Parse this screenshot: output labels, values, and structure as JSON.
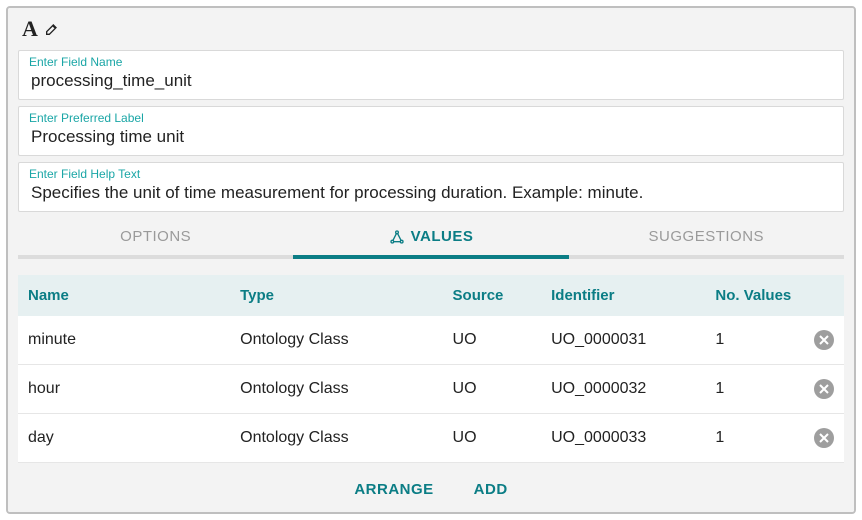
{
  "fields": {
    "name": {
      "placeholder": "Enter Field Name",
      "value": "processing_time_unit"
    },
    "label": {
      "placeholder": "Enter Preferred Label",
      "value": "Processing time unit"
    },
    "help": {
      "placeholder": "Enter Field Help Text",
      "value": "Specifies the unit of time measurement for processing duration. Example: minute."
    }
  },
  "tabs": {
    "options": "OPTIONS",
    "values": "VALUES",
    "suggestions": "SUGGESTIONS"
  },
  "table": {
    "headers": {
      "name": "Name",
      "type": "Type",
      "source": "Source",
      "identifier": "Identifier",
      "num": "No. Values"
    },
    "rows": [
      {
        "name": "minute",
        "type": "Ontology Class",
        "source": "UO",
        "identifier": "UO_0000031",
        "num": "1"
      },
      {
        "name": "hour",
        "type": "Ontology Class",
        "source": "UO",
        "identifier": "UO_0000032",
        "num": "1"
      },
      {
        "name": "day",
        "type": "Ontology Class",
        "source": "UO",
        "identifier": "UO_0000033",
        "num": "1"
      }
    ]
  },
  "actions": {
    "arrange": "ARRANGE",
    "add": "ADD"
  }
}
